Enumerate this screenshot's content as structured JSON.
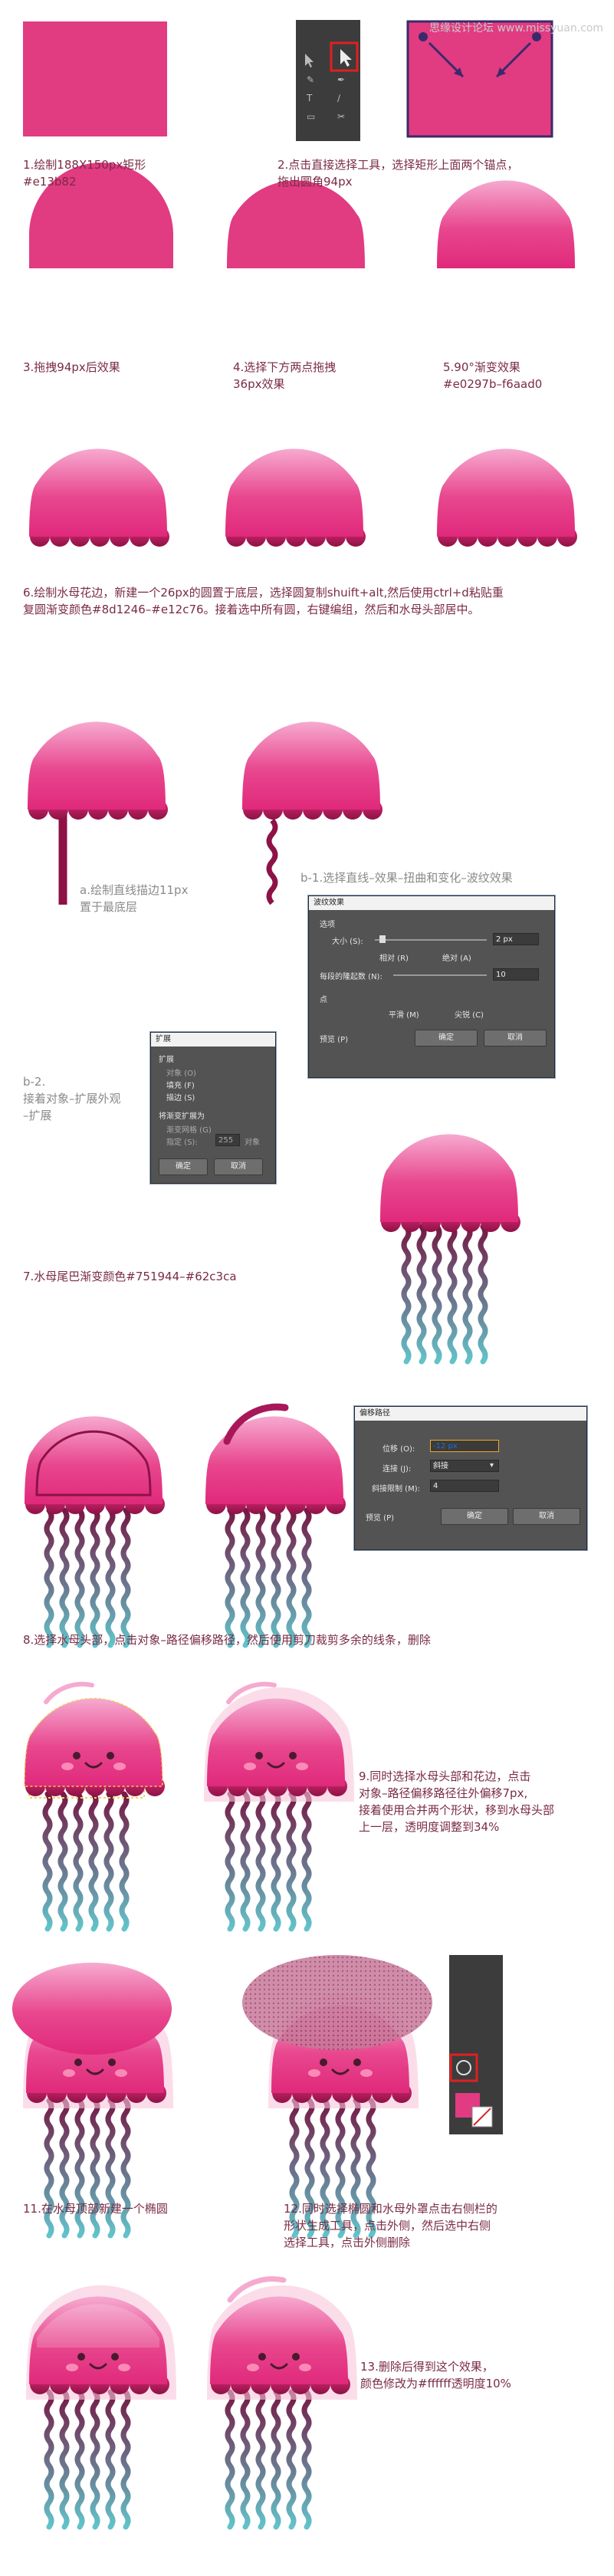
{
  "watermark": "思缘设计论坛 www.missyuan.com",
  "captions": {
    "s1": "1.绘制188X150px矩形\n#e13b82",
    "s2": "2.点击直接选择工具，选择矩形上面两个锚点，\n拖出圆角94px",
    "s3": "3.拖拽94px后效果",
    "s4": "4.选择下方两点拖拽\n36px效果",
    "s5": "5.90°渐变效果\n#e0297b–f6aad0",
    "s6": "6.绘制水母花边，新建一个26px的圆置于底层，选择圆复制shuift+alt,然后使用ctrl+d粘贴重\n复圆渐变颜色#8d1246–#e12c76。接着选中所有圆，右键编组，然后和水母头部居中。",
    "sa": "a.绘制直线描边11px\n置于最底层",
    "sb": "b-1.选择直线–效果–扭曲和变化–波纹效果",
    "sb2": "b-2.\n接着对象–扩展外观\n–扩展",
    "s7": "7.水母尾巴渐变颜色#751944–#62c3ca",
    "s8": "8.选择水母头部，点击对象–路径偏移路径，然后使用剪刀裁剪多余的线条，删除",
    "s9": "9.同时选择水母头部和花边，点击\n对象–路径偏移路径往外偏移7px,\n接着使用合并两个形状，移到水母头部\n上一层，透明度调整到34%",
    "s11": "11.在水母顶部新建一个椭圆",
    "s12": "12.同时选择椭圆和水母外罩点击右侧栏的\n形状生成工具，点击外侧，然后选中右侧\n选择工具，点击外侧删除",
    "s13": "13.删除后得到这个效果，\n颜色修改为#ffffff透明度10%"
  },
  "colors": {
    "rect": "#e13b82",
    "grad_top": "#f6aad0",
    "grad_bottom": "#e0297b",
    "ruffle_top": "#e12c76",
    "ruffle_bottom": "#8d1246",
    "tail_top": "#751944",
    "tail_bottom": "#62c3ca",
    "caption": "#7a2b44"
  },
  "wave_dialog": {
    "title": "波纹效果",
    "section_options": "选项",
    "size_label": "大小 (S):",
    "relative": "相对 (R)",
    "absolute": "绝对 (A)",
    "size_value": "2 px",
    "ridges_label": "每段的隆起数 (N):",
    "ridges_value": "10",
    "section_points": "点",
    "smooth": "平滑 (M)",
    "corner": "尖锐 (C)",
    "preview": "预览 (P)",
    "ok": "确定",
    "cancel": "取消"
  },
  "expand_dialog": {
    "title": "扩展",
    "section_expand": "扩展",
    "object": "对象 (O)",
    "fill": "填充 (F)",
    "stroke": "描边 (S)",
    "section_gradient": "将渐变扩展为",
    "gradient_mesh": "渐变网格 (G)",
    "specify": "指定 (S):",
    "specify_value": "255",
    "objects_suffix": "对象",
    "ok": "确定",
    "cancel": "取消"
  },
  "offset_dialog": {
    "title": "偏移路径",
    "offset_label": "位移 (O):",
    "offset_value": "-12 px",
    "joins_label": "连接 (J):",
    "joins_value": "斜接",
    "miter_label": "斜接限制 (M):",
    "miter_value": "4",
    "preview": "预览 (P)",
    "ok": "确定",
    "cancel": "取消"
  }
}
